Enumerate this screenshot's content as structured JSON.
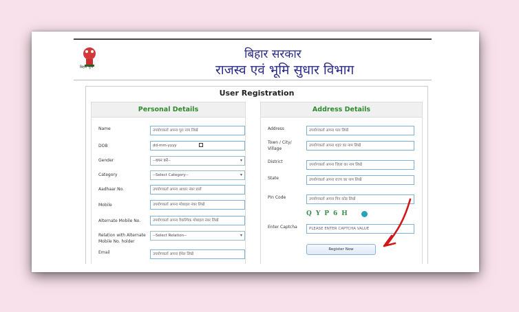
{
  "header": {
    "emblem_caption": "बिहार भूमि",
    "line1": "बिहार सरकार",
    "line2": "राजस्व एवं भूमि सुधार विभाग"
  },
  "form": {
    "title": "User Registration",
    "personal": {
      "heading": "Personal Details",
      "fields": [
        {
          "label": "Name",
          "placeholder": "उपयोगकर्ता अपना पूरा नाम लिखें"
        },
        {
          "label": "DOB",
          "placeholder": "dd-mm-yyyy"
        },
        {
          "label": "Gender",
          "placeholder": "--चयन करें--"
        },
        {
          "label": "Category",
          "placeholder": "--Select Category--"
        },
        {
          "label": "Aadhaar No.",
          "placeholder": "उपयोगकर्ता अपना आधार नंबर डालें"
        },
        {
          "label": "Mobile",
          "placeholder": "उपयोगकर्ता अपना मोबाइल नंबर लिखें"
        },
        {
          "label": "Alternate Mobile No.",
          "placeholder": "उपयोगकर्ता अपना वैकल्पिक मोबाइल नंबर लिखें"
        },
        {
          "label": "Relation with Alternate Mobile No. holder",
          "placeholder": "--Select Relation--"
        },
        {
          "label": "Email",
          "placeholder": "उपयोगकर्ता अपना ईमेल लिखें"
        }
      ]
    },
    "address": {
      "heading": "Address Details",
      "fields": [
        {
          "label": "Address",
          "placeholder": "उपयोगकर्ता अपना पता लिखें"
        },
        {
          "label": "Town / City/ Village",
          "placeholder": "उपयोगकर्ता अपना शहर का नाम लिखें"
        },
        {
          "label": "District",
          "placeholder": "उपयोगकर्ता अपना जिला का नाम लिखें"
        },
        {
          "label": "State",
          "placeholder": "उपयोगकर्ता अपना राज्य का नाम लिखें"
        },
        {
          "label": "Pin Code",
          "placeholder": "उपयोगकर्ता अपना पिन कोड लिखें"
        }
      ],
      "captcha_text": "QYP6H",
      "captcha_label": "Enter Captcha",
      "captcha_placeholder": "PLEASE ENTER CAPTCHA VALUE",
      "submit_label": "Register Now"
    }
  },
  "colors": {
    "page_bg": "#f8e1ea",
    "heading_green": "#2e8b2e",
    "title_blue": "#2a2a8a",
    "annotation_arrow": "#d0171b"
  }
}
